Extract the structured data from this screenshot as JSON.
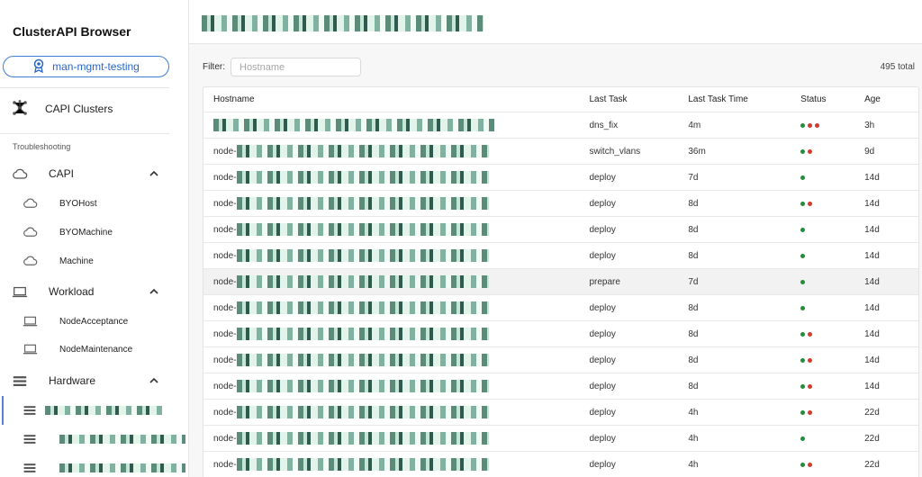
{
  "app": {
    "title": "ClusterAPI Browser",
    "context": "man-mgmt-testing"
  },
  "sidebar": {
    "top_item": {
      "label": "CAPI Clusters",
      "icon": "cluster-icon"
    },
    "section_label": "Troubleshooting",
    "groups": [
      {
        "label": "CAPI",
        "icon": "cloud-icon",
        "items": [
          "BYOHost",
          "BYOMachine",
          "Machine"
        ]
      },
      {
        "label": "Workload",
        "icon": "laptop-icon",
        "items": [
          "NodeAcceptance",
          "NodeMaintenance"
        ]
      },
      {
        "label": "Hardware",
        "icon": "list-icon",
        "items": []
      }
    ]
  },
  "filter": {
    "label": "Filter:",
    "placeholder": "Hostname",
    "value": ""
  },
  "total": "495 total",
  "table": {
    "columns": [
      "Hostname",
      "Last Task",
      "Last Task Time",
      "Status",
      "Age"
    ],
    "rows": [
      {
        "prefix": "",
        "task": "dns_fix",
        "time": "4m",
        "status": [
          "g",
          "r",
          "r"
        ],
        "age": "3h"
      },
      {
        "prefix": "node-",
        "task": "switch_vlans",
        "time": "36m",
        "status": [
          "g",
          "r"
        ],
        "age": "9d"
      },
      {
        "prefix": "node-",
        "task": "deploy",
        "time": "7d",
        "status": [
          "g"
        ],
        "age": "14d"
      },
      {
        "prefix": "node-",
        "task": "deploy",
        "time": "8d",
        "status": [
          "g",
          "r"
        ],
        "age": "14d"
      },
      {
        "prefix": "node-",
        "task": "deploy",
        "time": "8d",
        "status": [
          "g"
        ],
        "age": "14d"
      },
      {
        "prefix": "node-",
        "task": "deploy",
        "time": "8d",
        "status": [
          "g"
        ],
        "age": "14d"
      },
      {
        "prefix": "node-",
        "task": "prepare",
        "time": "7d",
        "status": [
          "g"
        ],
        "age": "14d",
        "highlight": true
      },
      {
        "prefix": "node-",
        "task": "deploy",
        "time": "8d",
        "status": [
          "g"
        ],
        "age": "14d"
      },
      {
        "prefix": "node-",
        "task": "deploy",
        "time": "8d",
        "status": [
          "g",
          "r"
        ],
        "age": "14d"
      },
      {
        "prefix": "node-",
        "task": "deploy",
        "time": "8d",
        "status": [
          "g",
          "r"
        ],
        "age": "14d"
      },
      {
        "prefix": "node-",
        "task": "deploy",
        "time": "8d",
        "status": [
          "g",
          "r"
        ],
        "age": "14d"
      },
      {
        "prefix": "node-",
        "task": "deploy",
        "time": "4h",
        "status": [
          "g",
          "r"
        ],
        "age": "22d"
      },
      {
        "prefix": "node-",
        "task": "deploy",
        "time": "4h",
        "status": [
          "g"
        ],
        "age": "22d"
      },
      {
        "prefix": "node-",
        "task": "deploy",
        "time": "4h",
        "status": [
          "g",
          "r"
        ],
        "age": "22d"
      }
    ]
  },
  "colors": {
    "accent": "#2a67c3",
    "status_ok": "#1f8f3a",
    "status_err": "#d63a2f"
  }
}
